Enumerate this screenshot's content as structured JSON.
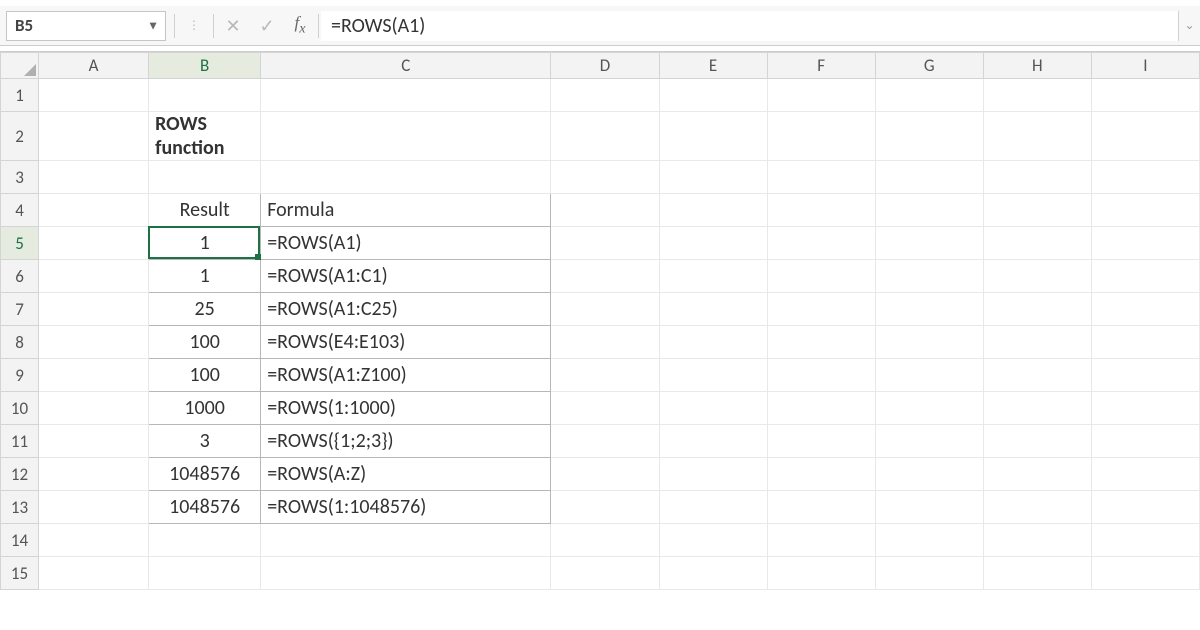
{
  "name_box": "B5",
  "formula_bar": "=ROWS(A1)",
  "columns": [
    "A",
    "B",
    "C",
    "D",
    "E",
    "F",
    "G",
    "H",
    "I"
  ],
  "row_count": 15,
  "active_cell": "B5",
  "heading": "ROWS function",
  "table": {
    "headers": {
      "result": "Result",
      "formula": "Formula"
    },
    "rows": [
      {
        "result": "1",
        "formula": "=ROWS(A1)"
      },
      {
        "result": "1",
        "formula": "=ROWS(A1:C1)"
      },
      {
        "result": "25",
        "formula": "=ROWS(A1:C25)"
      },
      {
        "result": "100",
        "formula": "=ROWS(E4:E103)"
      },
      {
        "result": "100",
        "formula": "=ROWS(A1:Z100)"
      },
      {
        "result": "1000",
        "formula": "=ROWS(1:1000)"
      },
      {
        "result": "3",
        "formula": "=ROWS({1;2;3})"
      },
      {
        "result": "1048576",
        "formula": "=ROWS(A:Z)"
      },
      {
        "result": "1048576",
        "formula": "=ROWS(1:1048576)"
      }
    ]
  },
  "chart_data": {
    "type": "table",
    "title": "ROWS function",
    "columns": [
      "Result",
      "Formula"
    ],
    "rows": [
      [
        "1",
        "=ROWS(A1)"
      ],
      [
        "1",
        "=ROWS(A1:C1)"
      ],
      [
        "25",
        "=ROWS(A1:C25)"
      ],
      [
        "100",
        "=ROWS(E4:E103)"
      ],
      [
        "100",
        "=ROWS(A1:Z100)"
      ],
      [
        "1000",
        "=ROWS(1:1000)"
      ],
      [
        "3",
        "=ROWS({1;2;3})"
      ],
      [
        "1048576",
        "=ROWS(A:Z)"
      ],
      [
        "1048576",
        "=ROWS(1:1048576)"
      ]
    ]
  }
}
